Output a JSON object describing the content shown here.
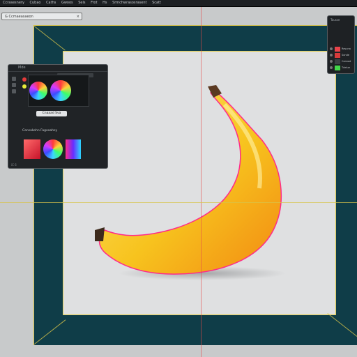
{
  "menu": {
    "items": [
      "Ccrasesnery",
      "Cubao",
      "Caths",
      "Gwoos",
      "Sels",
      "Frot",
      "Hs",
      "Srmchwrasosrasent",
      "Scatt"
    ]
  },
  "document_tab": {
    "title": "G Ccmaeasaeon",
    "close": "×"
  },
  "color_panel": {
    "header": "Mde",
    "button_label": "Cnaaad Sva",
    "section_label": "Cansakohn Fagoaahsy",
    "footer": "iC 6"
  },
  "layers_panel": {
    "title": "Tousse",
    "rows": [
      {
        "name": "Resuna",
        "color": "#e9434a"
      },
      {
        "name": "Sonde",
        "color": "#d73a3a"
      },
      {
        "name": "Cannod",
        "color": "#3b3f43"
      },
      {
        "name": "Tdelue",
        "color": "#43d84a"
      }
    ]
  },
  "colors": {
    "board": "#0f3d48",
    "guide": "#d7c34a",
    "banana": "#f7d53b",
    "accent_magenta": "#ff2b8a"
  }
}
